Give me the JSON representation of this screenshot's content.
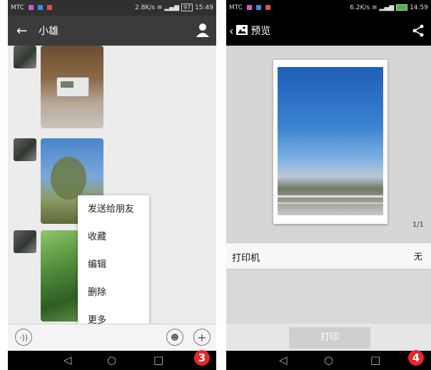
{
  "left": {
    "status": {
      "carrier": "MTC",
      "speed": "2.8K/s",
      "battery": "97",
      "time": "15:49"
    },
    "header": {
      "title": "小雄"
    },
    "context_menu": [
      "发送给朋友",
      "收藏",
      "编辑",
      "删除",
      "更多"
    ],
    "badge": "3"
  },
  "right": {
    "status": {
      "carrier": "MTC",
      "speed": "6.2K/s",
      "time": "14:59"
    },
    "header": {
      "title": "预览"
    },
    "page_indicator": "1/1",
    "printer": {
      "label": "打印机",
      "value": "无"
    },
    "print_button": "打印",
    "badge": "4"
  },
  "colors": {
    "accent_badge": "#e8262b",
    "appbar": "#383838",
    "statusbar": "#303030"
  }
}
